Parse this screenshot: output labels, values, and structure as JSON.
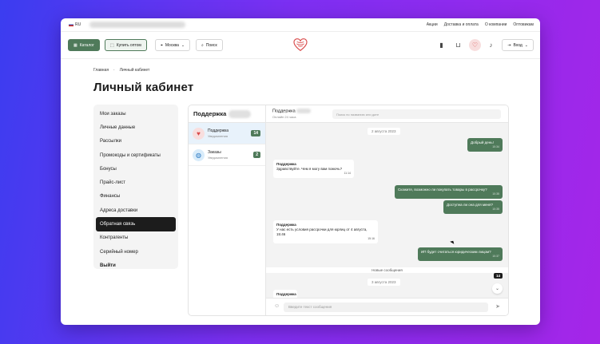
{
  "topbar": {
    "lang": "RU",
    "links": [
      "Акции",
      "Доставка и оплата",
      "О компании",
      "Оптовикам"
    ]
  },
  "header": {
    "catalog": "Каталог",
    "wholesale": "Купить оптом",
    "city": "Москва",
    "search": "Поиск",
    "login": "Вход"
  },
  "breadcrumb": [
    "Главная",
    "Личный кабинет"
  ],
  "page_title": "Личный кабинет",
  "sidebar": {
    "items": [
      {
        "label": "Мои заказы"
      },
      {
        "label": "Личные данные"
      },
      {
        "label": "Рассылки"
      },
      {
        "label": "Промокоды и сертификаты"
      },
      {
        "label": "Бонусы"
      },
      {
        "label": "Прайс-лист"
      },
      {
        "label": "Финансы"
      },
      {
        "label": "Адреса доставки"
      },
      {
        "label": "Обратная связь",
        "active": true
      },
      {
        "label": "Контрагенты"
      },
      {
        "label": "Серийный номер"
      },
      {
        "label": "Выйти",
        "bold": true
      }
    ]
  },
  "chat": {
    "list_title": "Поддержка",
    "conversations": [
      {
        "name": "Поддержка",
        "sub": "Уведомления",
        "badge": "14",
        "icon": "heart-logo-icon"
      },
      {
        "name": "Заказы",
        "sub": "Уведомления",
        "badge": "2",
        "icon": "globe-icon"
      }
    ],
    "header": {
      "title": "Поддержка",
      "status": "Онлайн 24 часа",
      "search_placeholder": "Поиск по названию или дате"
    },
    "messages": [
      {
        "kind": "date",
        "text": "2 августа 2023"
      },
      {
        "kind": "out",
        "text": "Добрый день!",
        "time": "10:34"
      },
      {
        "kind": "in",
        "author": "Поддержка",
        "text": "Здравствуйте. Чем я могу вам помочь?",
        "time": "11:14"
      },
      {
        "kind": "out",
        "text": "Скажите, возможно ли покупать товары в рассрочку?",
        "time": "10:35"
      },
      {
        "kind": "out",
        "text": "Доступна ли она для меня?",
        "time": "10:35"
      },
      {
        "kind": "in",
        "author": "Поддержка",
        "text": "У нас есть условия рассрочки для юрлиц от 4 августа, 15:46",
        "time": "15:16"
      },
      {
        "kind": "out",
        "text": "ИП будет считаться юридическим лицом?",
        "time": "10:37"
      },
      {
        "kind": "new",
        "text": "Новые сообщения"
      },
      {
        "kind": "date",
        "text": "3 августа 2023"
      },
      {
        "kind": "in",
        "author": "Поддержка"
      }
    ],
    "unread_badge": "14",
    "compose_placeholder": "Введите текст сообщения"
  },
  "colors": {
    "accent": "#4f7a5a",
    "dark": "#1c1c1c",
    "heart": "#d94a4a"
  }
}
